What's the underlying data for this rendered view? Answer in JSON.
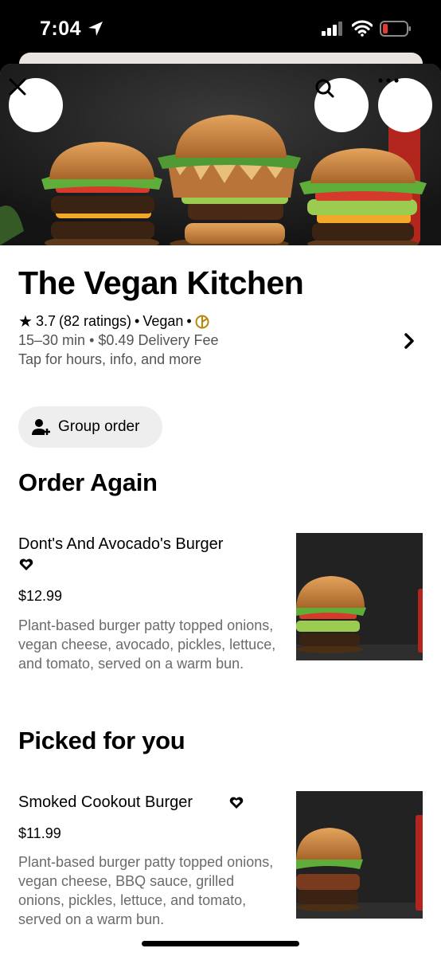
{
  "status_bar": {
    "time": "7:04"
  },
  "restaurant": {
    "name": "The Vegan Kitchen",
    "rating": "3.7",
    "ratings_count": "(82 ratings)",
    "sep": "•",
    "cuisine": "Vegan",
    "delivery_time": "15–30 min",
    "delivery_fee": "$0.49 Delivery Fee",
    "info_link": "Tap for hours, info, and more"
  },
  "group_order": {
    "label": "Group order"
  },
  "sections": {
    "order_again": {
      "title": "Order Again",
      "item": {
        "name": "Dont's And Avocado's Burger",
        "price": "$12.99",
        "description": "Plant-based burger patty topped onions, vegan cheese, avocado, pickles, lettuce, and tomato, served on a warm bun."
      }
    },
    "picked_for_you": {
      "title": "Picked for you",
      "item": {
        "name": "Smoked Cookout Burger",
        "price": "$11.99",
        "description": "Plant-based burger patty topped onions, vegan cheese, BBQ sauce, grilled onions, pickles, lettuce, and tomato, served on a warm bun."
      }
    }
  },
  "colors": {
    "accent_badge": "#b8860b",
    "muted_text": "#6b6b6b",
    "pill_bg": "#eeeeee"
  },
  "icons": [
    "location-arrow-icon",
    "signal-icon",
    "wifi-icon",
    "battery-icon",
    "close-icon",
    "search-icon",
    "more-icon",
    "star-icon",
    "badge-icon",
    "chevron-right-icon",
    "add-person-icon",
    "heart-icon"
  ]
}
